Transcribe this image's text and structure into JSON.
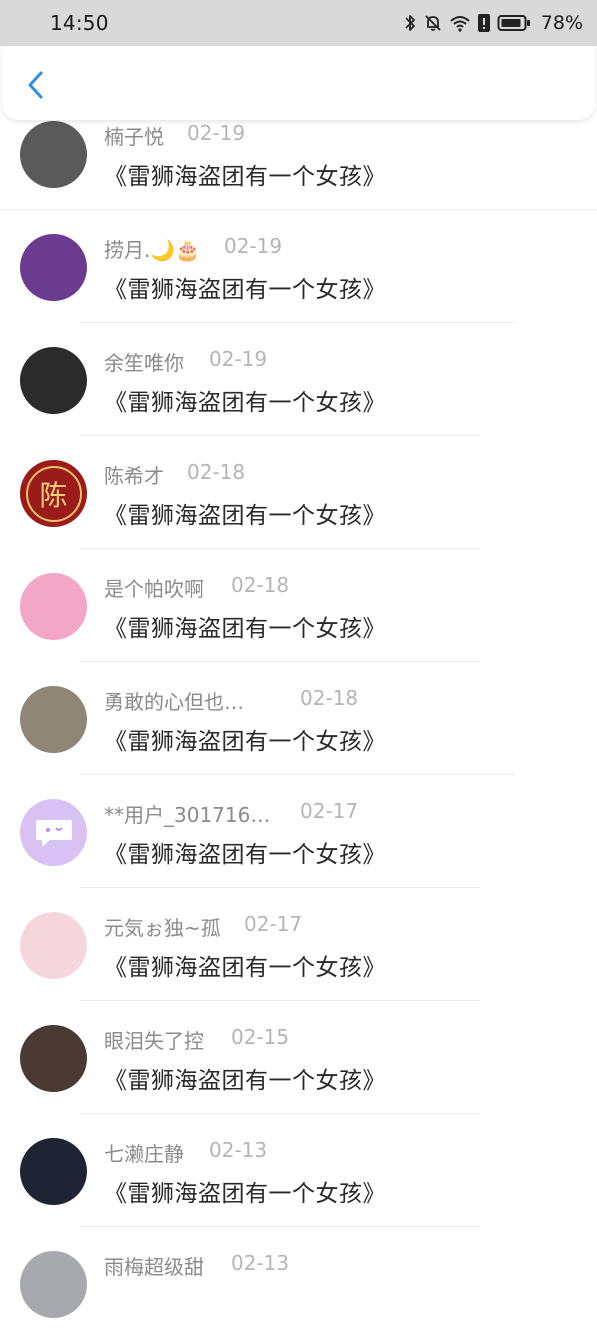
{
  "status_bar": {
    "time": "14:50",
    "battery": "78%"
  },
  "header": {
    "back_icon": "chevron-left-icon"
  },
  "items": [
    {
      "name": "楠子悦",
      "date": "02-19",
      "content": "《雷狮海盗团有一个女孩》",
      "avatar_color": "#5a5a5a",
      "avatar_glyph": ""
    },
    {
      "name": "捞月.🌙🎂",
      "date": "02-19",
      "content": "《雷狮海盗团有一个女孩》",
      "avatar_color": "#6a3b8f",
      "avatar_glyph": ""
    },
    {
      "name": "余笙唯你",
      "date": "02-19",
      "content": "《雷狮海盗团有一个女孩》",
      "avatar_color": "#2b2b2b",
      "avatar_glyph": ""
    },
    {
      "name": "陈希才",
      "date": "02-18",
      "content": "《雷狮海盗团有一个女孩》",
      "avatar_color": "#9b1b1b",
      "avatar_glyph": "陈"
    },
    {
      "name": "是个帕吹啊",
      "date": "02-18",
      "content": "《雷狮海盗团有一个女孩》",
      "avatar_color": "#f3a7c6",
      "avatar_glyph": ""
    },
    {
      "name": "勇敢的心但也…",
      "date": "02-18",
      "content": "《雷狮海盗团有一个女孩》",
      "avatar_color": "#8f8676",
      "avatar_glyph": ""
    },
    {
      "name": "**用户_301716…",
      "date": "02-17",
      "content": "《雷狮海盗团有一个女孩》",
      "avatar_color": "#d7c2f3",
      "avatar_glyph": ""
    },
    {
      "name": "元気ぉ独~孤",
      "date": "02-17",
      "content": "《雷狮海盗团有一个女孩》",
      "avatar_color": "#f5d6dc",
      "avatar_glyph": ""
    },
    {
      "name": "眼泪失了控",
      "date": "02-15",
      "content": "《雷狮海盗团有一个女孩》",
      "avatar_color": "#4a3a33",
      "avatar_glyph": ""
    },
    {
      "name": "七濑庄静",
      "date": "02-13",
      "content": "《雷狮海盗团有一个女孩》",
      "avatar_color": "#1e2433",
      "avatar_glyph": ""
    },
    {
      "name": "雨梅超级甜",
      "date": "02-13",
      "content": "",
      "avatar_color": "#a7a9ad",
      "avatar_glyph": ""
    }
  ]
}
